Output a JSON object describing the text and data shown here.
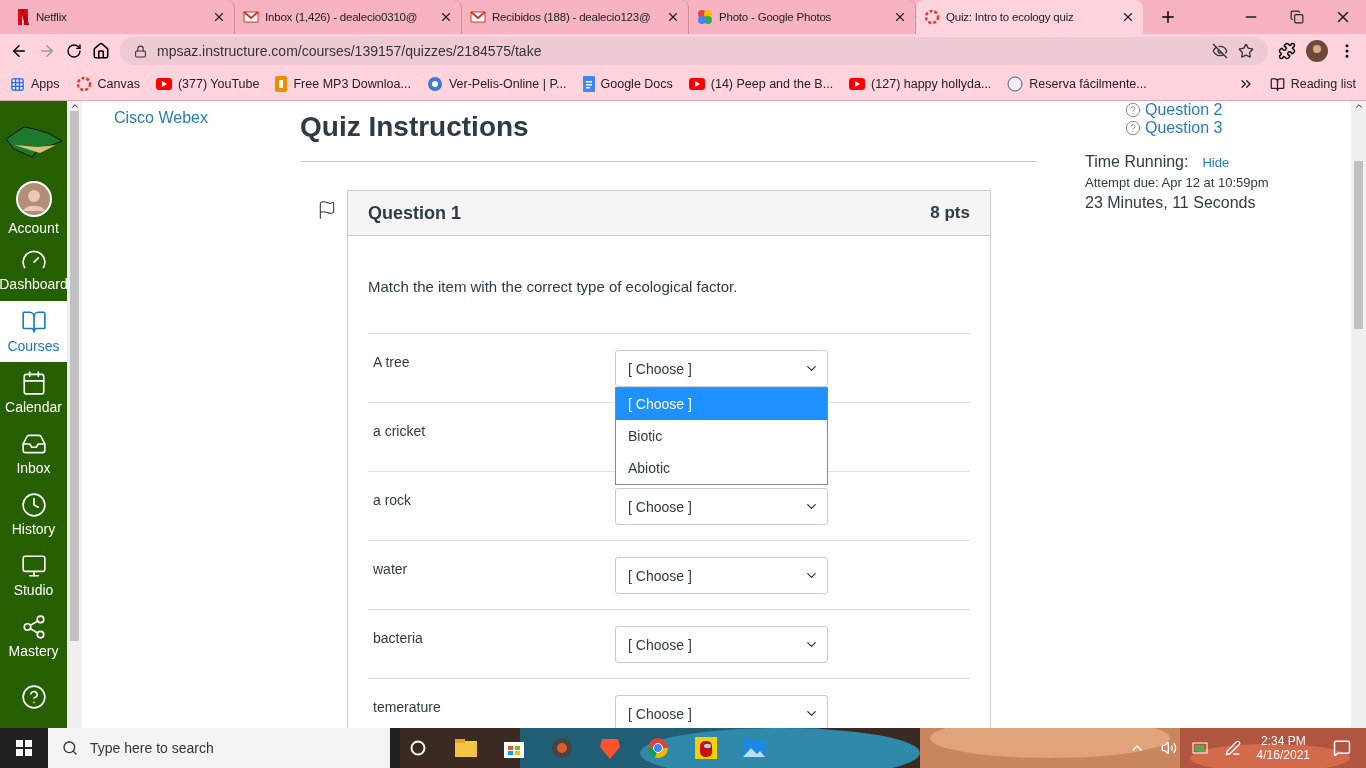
{
  "browser": {
    "tabs": [
      {
        "title": "Netflix",
        "selected": false
      },
      {
        "title": "Inbox (1,426) - dealecio0310@",
        "selected": false
      },
      {
        "title": "Recibidos (188) - dealecio123@",
        "selected": false
      },
      {
        "title": "Photo - Google Photos",
        "selected": false
      },
      {
        "title": "Quiz: Intro to ecology quiz",
        "selected": true
      }
    ],
    "address": "mpsaz.instructure.com/courses/139157/quizzes/2184575/take",
    "bookmarks": [
      "Apps",
      "Canvas",
      "(377) YouTube",
      "Free MP3 Downloa...",
      "Ver-Pelis-Online | P...",
      "Google Docs",
      "(14) Peep and the B...",
      "(127) happy hollyda...",
      "Reserva fácilmente..."
    ],
    "reading_list": "Reading list"
  },
  "nav": {
    "items": [
      {
        "label": "Account",
        "selected": false
      },
      {
        "label": "Dashboard",
        "selected": false
      },
      {
        "label": "Courses",
        "selected": true
      },
      {
        "label": "Calendar",
        "selected": false
      },
      {
        "label": "Inbox",
        "selected": false
      },
      {
        "label": "History",
        "selected": false
      },
      {
        "label": "Studio",
        "selected": false
      },
      {
        "label": "Mastery",
        "selected": false
      },
      {
        "selected": false
      }
    ]
  },
  "course_link": "Cisco Webex",
  "heading": "Quiz Instructions",
  "question": {
    "title": "Question 1",
    "points": "8 pts",
    "prompt": "Match the item with the correct type of ecological factor.",
    "rows": [
      {
        "item": "A tree",
        "value": "[ Choose ]",
        "options": [
          {
            "label": "[ Choose ]",
            "selected": true
          },
          {
            "label": "Biotic",
            "selected": false
          },
          {
            "label": "Abiotic",
            "selected": false
          }
        ]
      },
      {
        "item": "a cricket"
      },
      {
        "item": "a rock",
        "value": "[ Choose ]"
      },
      {
        "item": "water",
        "value": "[ Choose ]"
      },
      {
        "item": "bacteria",
        "value": "[ Choose ]"
      },
      {
        "item": "temerature",
        "value": "[ Choose ]"
      }
    ]
  },
  "sidebar": {
    "questions": [
      "Question 2",
      "Question 3"
    ],
    "timer_label": "Time Running:",
    "hide": "Hide",
    "due": "Attempt due: Apr 12 at 10:59pm",
    "elapsed": "23 Minutes, 11 Seconds"
  },
  "taskbar": {
    "search_placeholder": "Type here to search",
    "time": "2:34 PM",
    "date": "4/16/2021"
  }
}
